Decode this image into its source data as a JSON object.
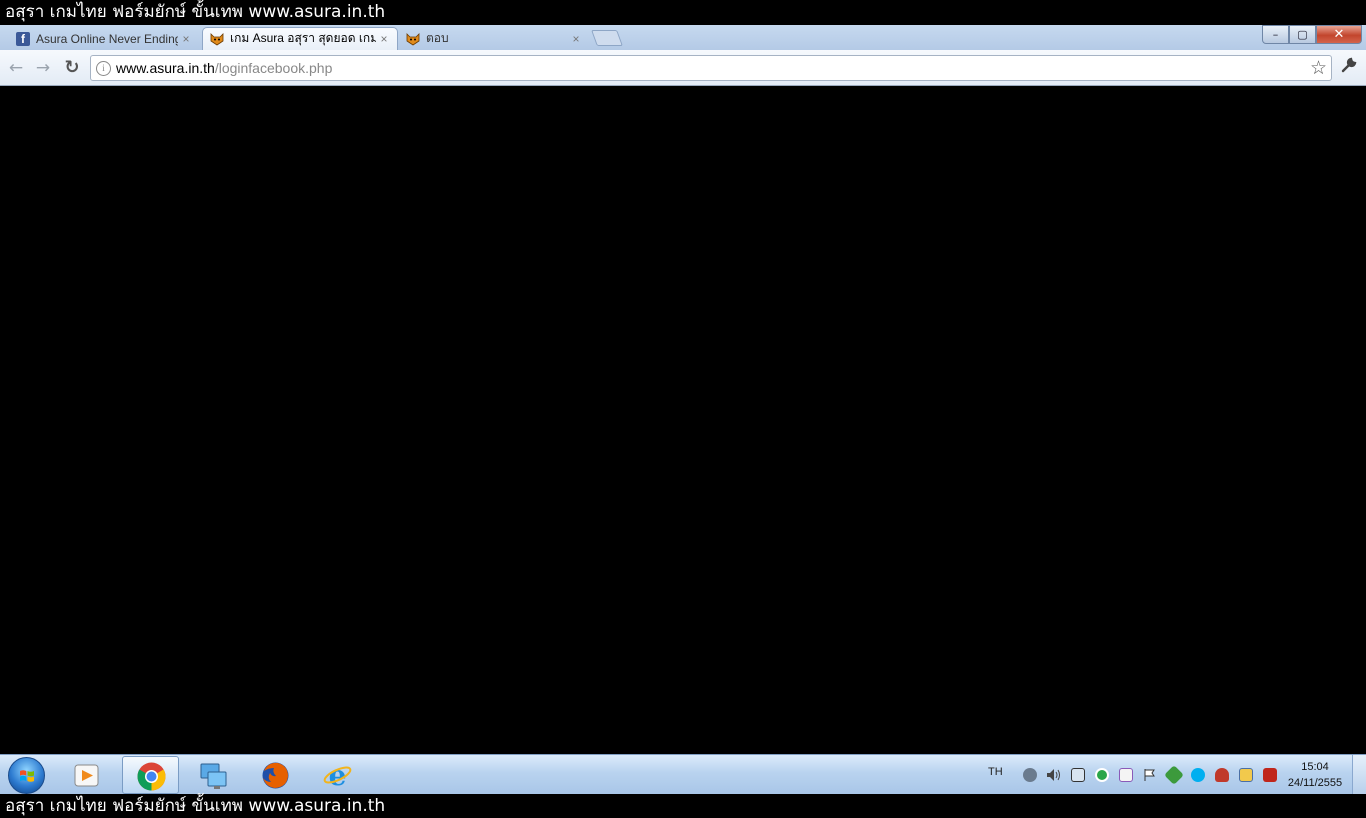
{
  "overlay": {
    "top_caption": "อสุรา เกมไทย ฟอร์มยักษ์ ขั้นเทพ www.asura.in.th",
    "bottom_caption": "อสุรา เกมไทย ฟอร์มยักษ์ ขั้นเทพ www.asura.in.th"
  },
  "browser": {
    "tabs": [
      {
        "title": "Asura Online Never Ending",
        "favicon": "facebook-icon",
        "active": false
      },
      {
        "title": "เกม Asura อสุรา สุดยอด เกมส์",
        "favicon": "asura-cat-icon",
        "active": true
      },
      {
        "title": "ตอบ",
        "favicon": "asura-cat-icon",
        "active": false
      }
    ],
    "close_glyph": "×",
    "fb_letter": "f",
    "window_buttons": {
      "minimize": "–",
      "maximize": "▢",
      "close": "✕"
    },
    "nav": {
      "back": "←",
      "forward": "→",
      "reload": "↻"
    },
    "address": {
      "host": "www.asura.in.th",
      "path": "/loginfacebook.php",
      "page_icon": "i"
    },
    "star": "☆",
    "wrench": "🔧"
  },
  "taskbar": {
    "pinned": [
      {
        "name": "media-player-icon",
        "active": false
      },
      {
        "name": "chrome-icon",
        "active": true
      },
      {
        "name": "network-icon",
        "active": false
      },
      {
        "name": "firefox-icon",
        "active": false
      },
      {
        "name": "internet-explorer-icon",
        "active": false
      }
    ],
    "language": "TH",
    "tray_icons": [
      "network-adapter-icon",
      "volume-icon",
      "network-icon",
      "green-circle-icon",
      "pen-icon",
      "flag-icon",
      "green-app-icon",
      "skype-icon",
      "user-icon",
      "monitor-icon",
      "pdf-icon"
    ],
    "clock": {
      "time": "15:04",
      "date": "24/11/2555"
    }
  },
  "colors": {
    "content_background": "#000000",
    "tabstrip": "#b4cae6",
    "taskbar": "#b9d3ef"
  }
}
